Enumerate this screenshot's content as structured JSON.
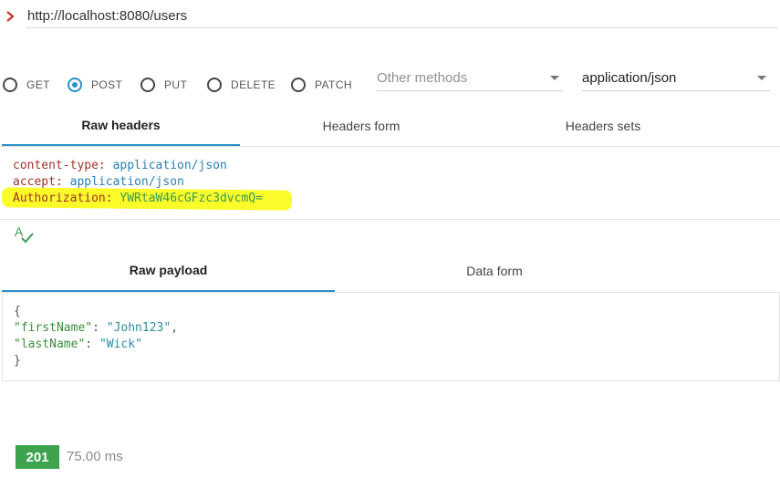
{
  "url": {
    "value": "http://localhost:8080/users"
  },
  "methods": [
    {
      "label": "GET",
      "checked": false
    },
    {
      "label": "POST",
      "checked": true
    },
    {
      "label": "PUT",
      "checked": false
    },
    {
      "label": "DELETE",
      "checked": false
    },
    {
      "label": "PATCH",
      "checked": false
    }
  ],
  "other_methods": {
    "placeholder": "Other methods"
  },
  "content_type_select": {
    "value": "application/json"
  },
  "headers_tabs": [
    {
      "label": "Raw headers",
      "active": true
    },
    {
      "label": "Headers form",
      "active": false
    },
    {
      "label": "Headers sets",
      "active": false
    }
  ],
  "headers": [
    {
      "name": "content-type",
      "value": "application/json"
    },
    {
      "name": "accept",
      "value": "application/json"
    },
    {
      "name": "Authorization",
      "value": "YWRtaW46cGFzc3dvcmQ="
    }
  ],
  "payload_tabs": [
    {
      "label": "Raw payload",
      "active": true
    },
    {
      "label": "Data form",
      "active": false
    }
  ],
  "payload": {
    "open": "{",
    "close": "}",
    "fields": [
      {
        "key": "\"firstName\"",
        "value": "\"John123\"",
        "comma": ","
      },
      {
        "key": "\"lastName\"",
        "value": "\"Wick\"",
        "comma": ""
      }
    ]
  },
  "response": {
    "status": "201",
    "time": "75.00 ms"
  },
  "colors": {
    "accent": "#2a91c9",
    "status_ok": "#3ea24f",
    "highlight": "#fbfb2a"
  },
  "icons": {
    "url_toggle": "chevron-right-icon",
    "spellcheck": "spellcheck-icon"
  }
}
